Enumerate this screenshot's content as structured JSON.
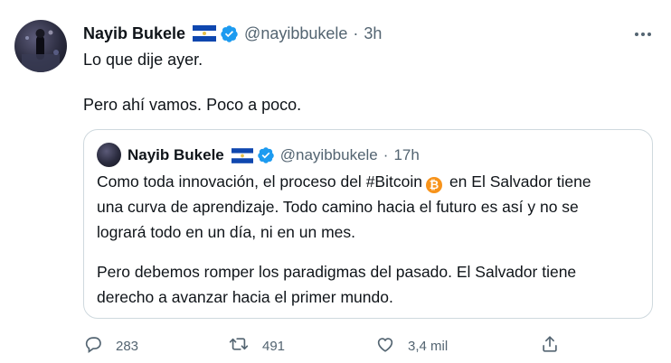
{
  "author": {
    "name": "Nayib Bukele",
    "handle": "@nayibbukele",
    "separator": "·",
    "time": "3h"
  },
  "tweet": {
    "line1": "Lo que dije ayer.",
    "line2": "Pero ahí vamos. Poco a poco."
  },
  "quoted": {
    "name": "Nayib Bukele",
    "handle": "@nayibbukele",
    "separator": "·",
    "time": "17h",
    "line1_before": "Como toda innovación, el proceso del ",
    "hashtag": "#Bitcoin",
    "btc_symbol": "₿",
    "line1_after": "en El Salvador tiene",
    "line2": "una curva de aprendizaje. Todo camino hacia el futuro es así y no se",
    "line3": "logrará todo en un día, ni en un mes.",
    "line4": "Pero debemos romper los paradigmas del pasado. El Salvador tiene",
    "line5": "derecho a avanzar hacia el primer mundo."
  },
  "actions": {
    "replies": "283",
    "retweets": "491",
    "likes": "3,4 mil"
  },
  "icons": [
    "more-icon",
    "verified-icon",
    "flag-icon",
    "reply-icon",
    "retweet-icon",
    "like-icon",
    "share-icon",
    "bitcoin-icon"
  ],
  "colors": {
    "text": "#0f1419",
    "secondary": "#536471",
    "verified": "#1d9bf0",
    "bitcoin": "#f7931a",
    "border": "#cfd9de",
    "flag_blue": "#0f47af"
  }
}
